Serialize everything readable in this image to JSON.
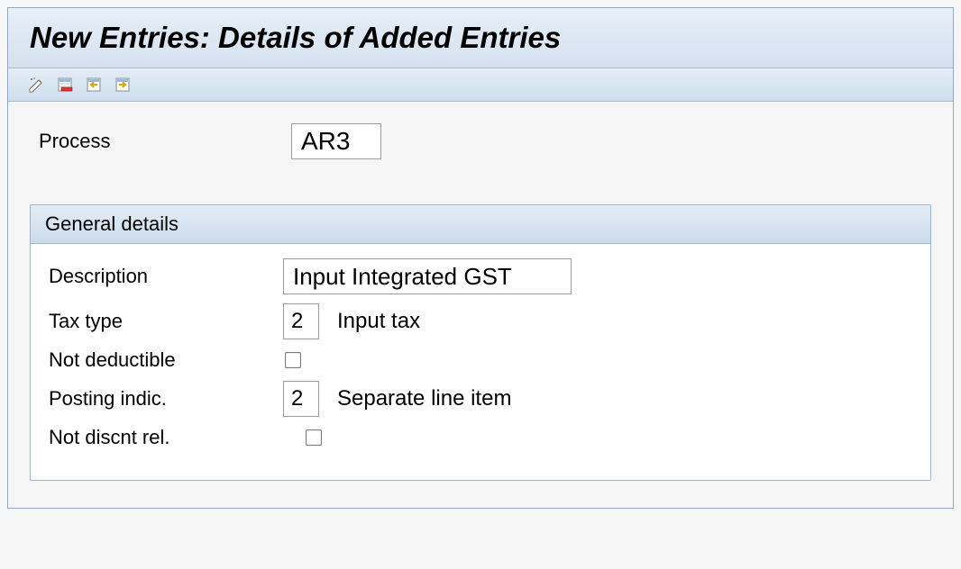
{
  "window": {
    "title": "New Entries: Details of Added Entries"
  },
  "fields": {
    "process_label": "Process",
    "process_value": "AR3"
  },
  "group": {
    "header": "General details",
    "description_label": "Description",
    "description_value": "Input Integrated GST",
    "tax_type_label": "Tax type",
    "tax_type_value": "2",
    "tax_type_text": "Input tax",
    "not_deductible_label": "Not deductible",
    "posting_indic_label": "Posting indic.",
    "posting_indic_value": "2",
    "posting_indic_text": "Separate line item",
    "not_discnt_rel_label": "Not discnt rel."
  }
}
